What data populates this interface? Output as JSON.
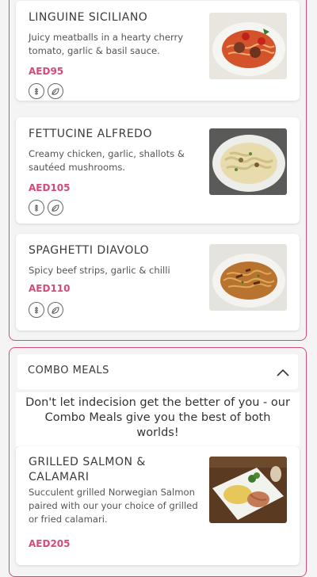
{
  "pasta_items": [
    {
      "name": "LINGUINE SICILIANO",
      "description": "Juicy meatballs in a hearty cherry tomato, garlic & basil sauce.",
      "price": "AED95",
      "diet_icons": [
        "gluten-icon",
        "vegetarian-leaf-icon"
      ]
    },
    {
      "name": "FETTUCINE ALFREDO",
      "description": "Creamy chicken, garlic, shallots & sautéed mushrooms.",
      "price": "AED105",
      "diet_icons": [
        "gluten-icon",
        "vegetarian-leaf-icon"
      ]
    },
    {
      "name": "SPAGHETTI DIAVOLO",
      "description": "Spicy beef strips, garlic & chilli",
      "price": "AED110",
      "diet_icons": [
        "gluten-icon",
        "vegetarian-leaf-icon"
      ]
    }
  ],
  "combo": {
    "title": "COMBO MEALS",
    "toggle_icon": "chevron-up-icon",
    "intro": "Don't let indecision get the better of you - our Combo Meals give you the best of both worlds!",
    "items": [
      {
        "name": "GRILLED SALMON & CALAMARI",
        "description": "Succulent grilled Norwegian Salmon paired with our your choice of grilled or fried calamari.",
        "price": "AED205"
      }
    ]
  },
  "colors": {
    "accent": "#d64a79",
    "border": "#d64a79",
    "background": "#f4f4f4"
  }
}
